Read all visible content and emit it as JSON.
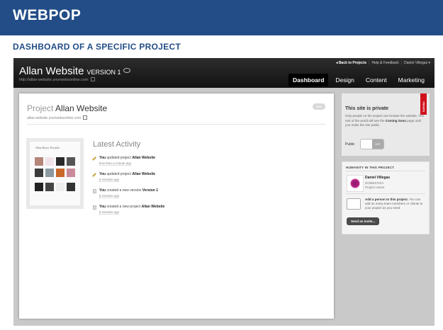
{
  "slide": {
    "title": "WEBPOP",
    "subtitle": "DASHBOARD  OF A SPECIFIC PROJECT"
  },
  "app": {
    "title": "Allan Website",
    "version": "VERSION 1",
    "url": "http://allan-website.yourwebsonline.com",
    "top_links": {
      "back": "Back to Projects",
      "help": "Help & Feedback",
      "user": "Daniel Villegas"
    },
    "nav": [
      "Dashboard",
      "Design",
      "Content",
      "Marketing"
    ]
  },
  "project": {
    "label": "Project",
    "name": "Allan Website",
    "url": "allan-website.yourwebsonline.com",
    "edit_label": "Edit",
    "thumb_title": "Allan Reyes' Porfolio"
  },
  "activity": {
    "title": "Latest Activity",
    "items": [
      {
        "prefix": "You",
        "action": "updated project",
        "target": "Allan Website",
        "time": "less than a minute ago"
      },
      {
        "prefix": "You",
        "action": "updated project",
        "target": "Allan Website",
        "time": "8 minutes ago"
      },
      {
        "prefix": "You",
        "action": "created a new version",
        "target": "Version 1",
        "time": "8 minutes ago"
      },
      {
        "prefix": "You",
        "action": "created a new project",
        "target": "Allan Website",
        "time": "8 minutes ago"
      }
    ]
  },
  "privacy": {
    "ribbon": "PRIVATE",
    "title": "This site is private",
    "text_a": "Only people on the project can browse the website. The rest of the world will see the ",
    "coming_soon": "Coming Soon",
    "text_b": " page until you make the site public.",
    "public_label": "Public",
    "toggle_label": "OFF"
  },
  "humanity": {
    "title": "HUMANITY IN THIS PROJECT",
    "member": {
      "name": "Daniel Villegas",
      "org": "DOMESTIKA",
      "role": "Project owner"
    },
    "add_bold": "Add a person to this project.",
    "add_text": " You can add as many team members or clients to your project as you need.",
    "invite_label": "Send an invite..."
  },
  "colors": {
    "banner": "#224d87",
    "private_ribbon": "#d0111b",
    "avatar": "#9c1a72"
  }
}
